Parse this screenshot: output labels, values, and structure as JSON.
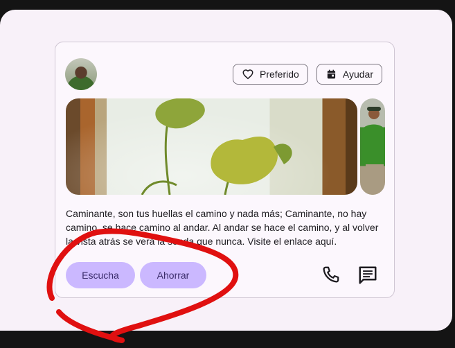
{
  "card": {
    "chips": {
      "favorite_label": "Preferido",
      "help_label": "Ayudar"
    },
    "body_text": "Caminante, son tus huellas el camino y nada más; Caminante, no hay camino, se hace camino al andar. Al andar se hace el camino, y al volver la vista atrás se verá la senda que nunca. Visite el enlace aquí.",
    "buttons": {
      "listen_label": "Escucha",
      "save_label": "Ahorrar"
    },
    "icons": [
      "heart-icon",
      "calendar-icon",
      "phone-icon",
      "message-icon"
    ]
  },
  "colors": {
    "surface": "#f8f1f9",
    "button_fill": "#cbb8ff",
    "annotation_red": "#e01010"
  }
}
